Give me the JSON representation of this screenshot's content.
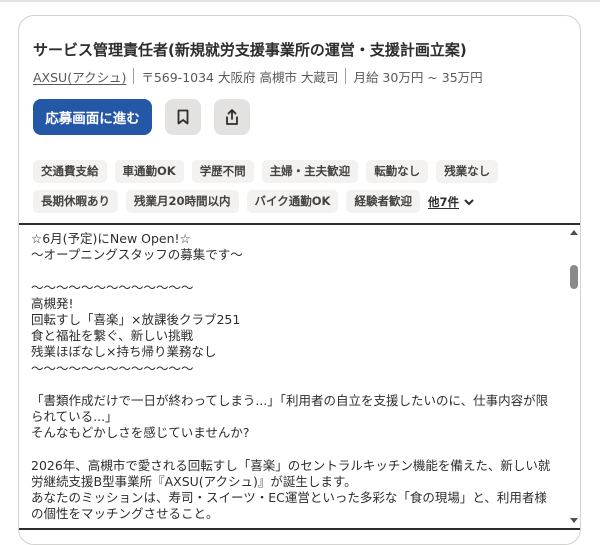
{
  "job": {
    "title": "サービス管理責任者(新規就労支援事業所の運営・支援計画立案)",
    "company": "AXSU(アクシュ)",
    "address": "〒569-1034 大阪府 高槻市 大蔵司",
    "salary": "月給 30万円 ~ 35万円"
  },
  "actions": {
    "apply_label": "応募画面に進む",
    "save_icon": "bookmark-icon",
    "share_icon": "share-icon"
  },
  "tags": [
    "交通費支給",
    "車通勤OK",
    "学歴不問",
    "主婦・主夫歓迎",
    "転勤なし",
    "残業なし",
    "長期休暇あり",
    "残業月20時間以内",
    "バイク通勤OK",
    "経験者歓迎"
  ],
  "more_tags": {
    "label": "他7件",
    "icon": "chevron-down-icon"
  },
  "description": "☆6月(予定)にNew Open!☆\n〜オープニングスタッフの募集です〜\n\n〜〜〜〜〜〜〜〜〜〜〜〜〜\n高槻発!\n回転すし「喜楽」×放課後クラブ251\n食と福祉を繋ぐ、新しい挑戦\n残業ほぼなし×持ち帰り業務なし\n〜〜〜〜〜〜〜〜〜〜〜〜〜\n\n「書類作成だけで一日が終わってしまう...」「利用者の自立を支援したいのに、仕事内容が限られている...」\nそんなもどかしさを感じていませんか?\n\n2026年、高槻市で愛される回転すし「喜楽」のセントラルキッチン機能を備えた、新しい就労継続支援B型事業所『AXSU(アクシュ)』が誕生します。\nあなたのミッションは、寿司・スイーツ・EC運営といった多彩な「食の現場」と、利用者様の個性をマッチングさせること。"
}
